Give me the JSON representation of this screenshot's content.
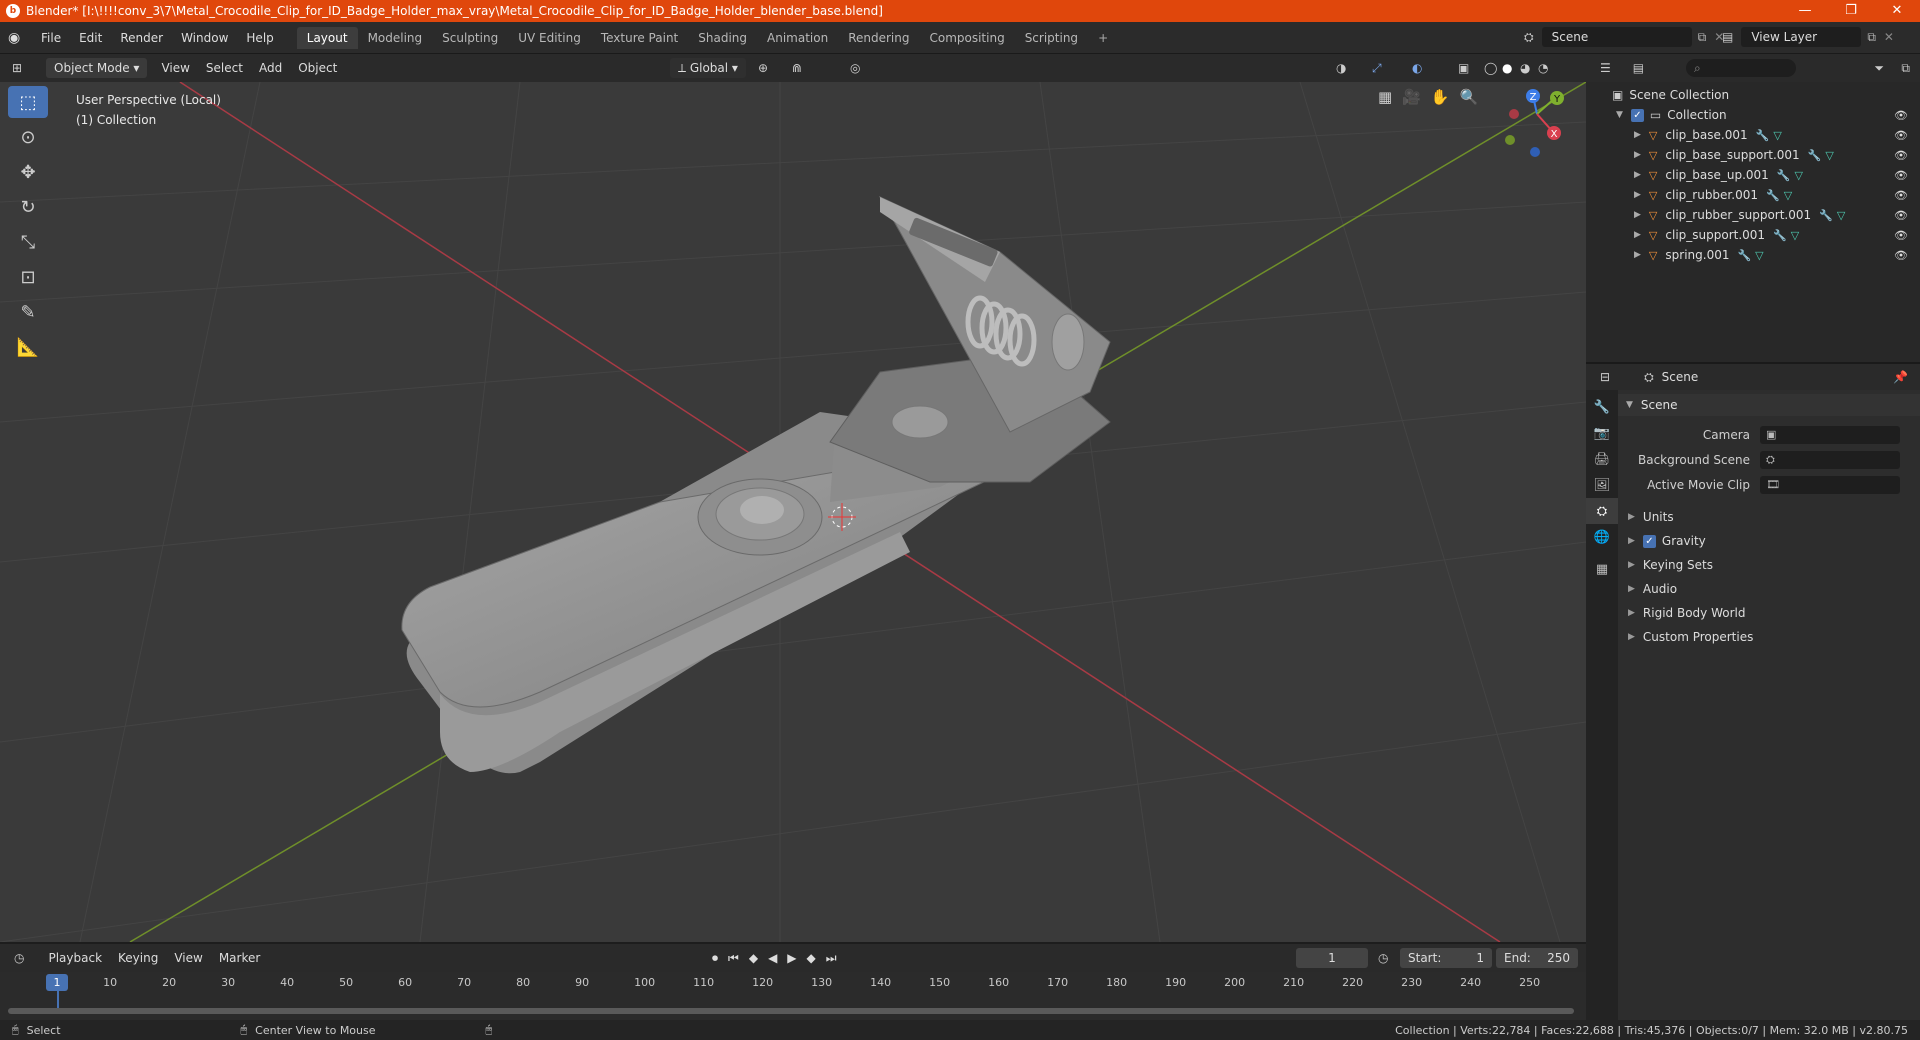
{
  "window": {
    "title": "Blender* [I:\\!!!!conv_3\\7\\Metal_Crocodile_Clip_for_ID_Badge_Holder_max_vray\\Metal_Crocodile_Clip_for_ID_Badge_Holder_blender_base.blend]",
    "minimize": "—",
    "maximize": "❐",
    "close": "✕"
  },
  "menu": [
    "File",
    "Edit",
    "Render",
    "Window",
    "Help"
  ],
  "workspaces": [
    "Layout",
    "Modeling",
    "Sculpting",
    "UV Editing",
    "Texture Paint",
    "Shading",
    "Animation",
    "Rendering",
    "Compositing",
    "Scripting"
  ],
  "workspace_add": "+",
  "scene_name": "Scene",
  "view_layer": "View Layer",
  "viewport_header": {
    "mode": "Object Mode",
    "menus": [
      "View",
      "Select",
      "Add",
      "Object"
    ],
    "orientation": "Global"
  },
  "viewport": {
    "perspective": "User Perspective (Local)",
    "collection": "(1) Collection",
    "gizmo": {
      "z": "Z",
      "y": "Y",
      "x": "X"
    }
  },
  "outliner": {
    "search_placeholder": "",
    "root": "Scene Collection",
    "collection": "Collection",
    "objects": [
      "clip_base.001",
      "clip_base_support.001",
      "clip_base_up.001",
      "clip_rubber.001",
      "clip_rubber_support.001",
      "clip_support.001",
      "spring.001"
    ]
  },
  "properties": {
    "header": "Scene",
    "panel": "Scene",
    "camera_label": "Camera",
    "background_label": "Background Scene",
    "movie_clip_label": "Active Movie Clip",
    "subpanels": [
      "Units",
      "Gravity",
      "Keying Sets",
      "Audio",
      "Rigid Body World",
      "Custom Properties"
    ]
  },
  "timeline": {
    "menus": [
      "Playback",
      "Keying",
      "View",
      "Marker"
    ],
    "current_frame": "1",
    "start_label": "Start:",
    "start": "1",
    "end_label": "End:",
    "end": "250",
    "ticks": [
      "1",
      "10",
      "20",
      "30",
      "40",
      "50",
      "60",
      "70",
      "80",
      "90",
      "100",
      "110",
      "120",
      "130",
      "140",
      "150",
      "160",
      "170",
      "180",
      "190",
      "200",
      "210",
      "220",
      "230",
      "240",
      "250"
    ]
  },
  "status": {
    "left1": "Select",
    "left2": "Center View to Mouse",
    "right": "Collection | Verts:22,784 | Faces:22,688 | Tris:45,376 | Objects:0/7 | Mem: 32.0 MB | v2.80.75"
  },
  "colors": {
    "accent": "#4772b3",
    "titlebar": "#e0470c",
    "x_axis": "#d9404f",
    "y_axis": "#7fb02e",
    "z_axis": "#3d7de8"
  }
}
